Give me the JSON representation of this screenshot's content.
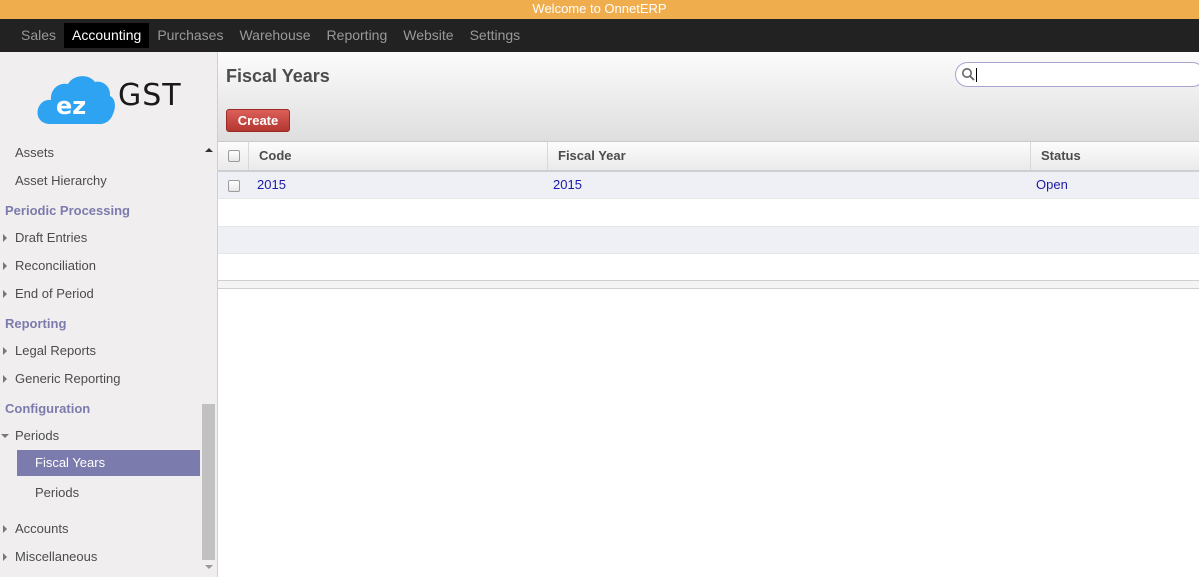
{
  "banner": {
    "text": "Welcome to OnnetERP"
  },
  "topnav": {
    "items": [
      {
        "label": "Sales"
      },
      {
        "label": "Accounting"
      },
      {
        "label": "Purchases"
      },
      {
        "label": "Warehouse"
      },
      {
        "label": "Reporting"
      },
      {
        "label": "Website"
      },
      {
        "label": "Settings"
      }
    ],
    "active": "Accounting"
  },
  "logo": {
    "mark": "ez",
    "text": "GST",
    "color": "#2ea3f2"
  },
  "sidebar": {
    "assets": "Assets",
    "asset_hierarchy": "Asset Hierarchy",
    "periodic_header": "Periodic Processing",
    "draft_entries": "Draft Entries",
    "reconciliation": "Reconciliation",
    "end_of_period": "End of Period",
    "reporting_header": "Reporting",
    "legal_reports": "Legal Reports",
    "generic_reporting": "Generic Reporting",
    "config_header": "Configuration",
    "periods_group": "Periods",
    "fiscal_years": "Fiscal Years",
    "periods": "Periods",
    "accounts": "Accounts",
    "miscellaneous": "Miscellaneous"
  },
  "main": {
    "title": "Fiscal Years",
    "search_placeholder": "",
    "create_label": "Create"
  },
  "table": {
    "columns": [
      "Code",
      "Fiscal Year",
      "Status"
    ],
    "rows": [
      {
        "code": "2015",
        "fiscal_year": "2015",
        "status": "Open"
      }
    ]
  },
  "colors": {
    "banner": "#f0ad4e",
    "topbar": "#222222",
    "accent": "#7c7bad",
    "create_button": "#c9403a",
    "link": "#1a1aa6"
  }
}
